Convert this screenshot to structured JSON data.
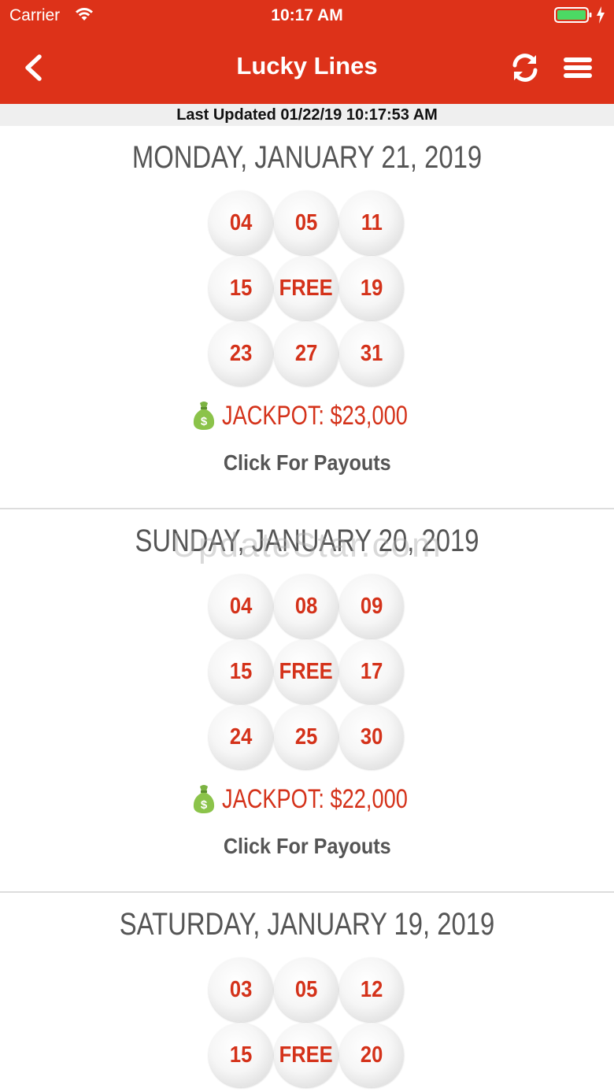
{
  "status_bar": {
    "carrier": "Carrier",
    "time": "10:17 AM"
  },
  "nav": {
    "title": "Lucky Lines"
  },
  "last_updated": "Last Updated 01/22/19 10:17:53 AM",
  "watermark": "UpdateStar.com",
  "colors": {
    "brand_red": "#dd3219",
    "number_red": "#d4321a",
    "date_gray": "#555555"
  },
  "draws": [
    {
      "date": "MONDAY, JANUARY 21, 2019",
      "balls": [
        "04",
        "05",
        "11",
        "15",
        "FREE",
        "19",
        "23",
        "27",
        "31"
      ],
      "jackpot": "JACKPOT: $23,000",
      "payouts_label": "Click For Payouts"
    },
    {
      "date": "SUNDAY, JANUARY 20, 2019",
      "balls": [
        "04",
        "08",
        "09",
        "15",
        "FREE",
        "17",
        "24",
        "25",
        "30"
      ],
      "jackpot": "JACKPOT: $22,000",
      "payouts_label": "Click For Payouts"
    },
    {
      "date": "SATURDAY, JANUARY 19, 2019",
      "balls": [
        "03",
        "05",
        "12",
        "15",
        "FREE",
        "20"
      ],
      "jackpot": "",
      "payouts_label": ""
    }
  ]
}
